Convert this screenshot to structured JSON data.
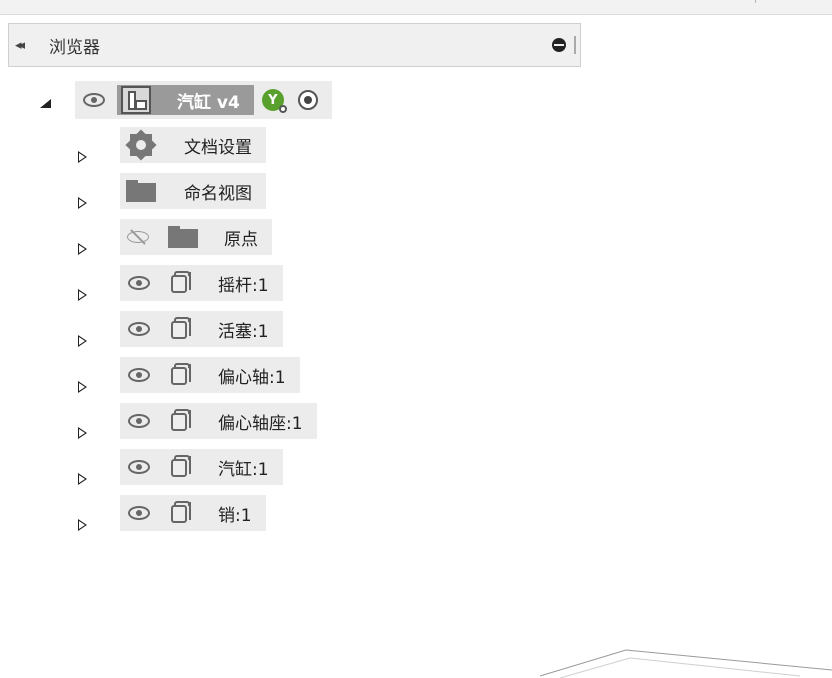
{
  "browser": {
    "title": "浏览器",
    "collapse_glyph": "◂◂"
  },
  "root": {
    "name": "汽缸 v4",
    "badge": "Y"
  },
  "items": [
    {
      "label": "文档设置",
      "icon": "gear-icon"
    },
    {
      "label": "命名视图",
      "icon": "folder-icon"
    },
    {
      "label": "原点",
      "icon": "folder-icon",
      "hidden": true
    },
    {
      "label": "摇杆:1",
      "icon": "component-icon"
    },
    {
      "label": "活塞:1",
      "icon": "component-icon"
    },
    {
      "label": "偏心轴:1",
      "icon": "component-icon"
    },
    {
      "label": "偏心轴座:1",
      "icon": "component-icon"
    },
    {
      "label": "汽缸:1",
      "icon": "component-icon"
    },
    {
      "label": "销:1",
      "icon": "component-icon"
    }
  ],
  "colors": {
    "panel_bg": "#f0f0f0",
    "chip_bg": "#ececec",
    "selected_bg": "#9a9a9a",
    "badge_green": "#5aa02c",
    "icon_gray": "#666666"
  }
}
